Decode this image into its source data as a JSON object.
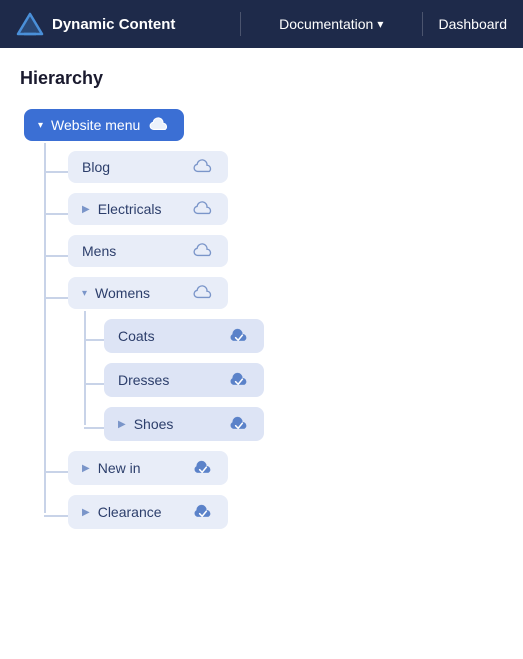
{
  "nav": {
    "logo_text": "Dynamic Content",
    "docs_label": "Documentation",
    "dashboard_label": "Dashboard"
  },
  "page": {
    "title": "Hierarchy"
  },
  "tree": {
    "root": {
      "label": "Website menu",
      "expanded": true,
      "icon": "cloud"
    },
    "level1": [
      {
        "label": "Blog",
        "expanded": false,
        "hasChevron": false,
        "icon": "cloud"
      },
      {
        "label": "Electricals",
        "expanded": false,
        "hasChevron": true,
        "icon": "cloud"
      },
      {
        "label": "Mens",
        "expanded": false,
        "hasChevron": false,
        "icon": "cloud"
      },
      {
        "label": "Womens",
        "expanded": true,
        "hasChevron": true,
        "icon": "cloud",
        "children": [
          {
            "label": "Coats",
            "icon": "cloud-check"
          },
          {
            "label": "Dresses",
            "icon": "cloud-check"
          },
          {
            "label": "Shoes",
            "hasChevron": true,
            "icon": "cloud-check"
          }
        ]
      },
      {
        "label": "New in",
        "expanded": false,
        "hasChevron": true,
        "icon": "cloud-check"
      },
      {
        "label": "Clearance",
        "expanded": false,
        "hasChevron": true,
        "icon": "cloud-check"
      }
    ]
  }
}
